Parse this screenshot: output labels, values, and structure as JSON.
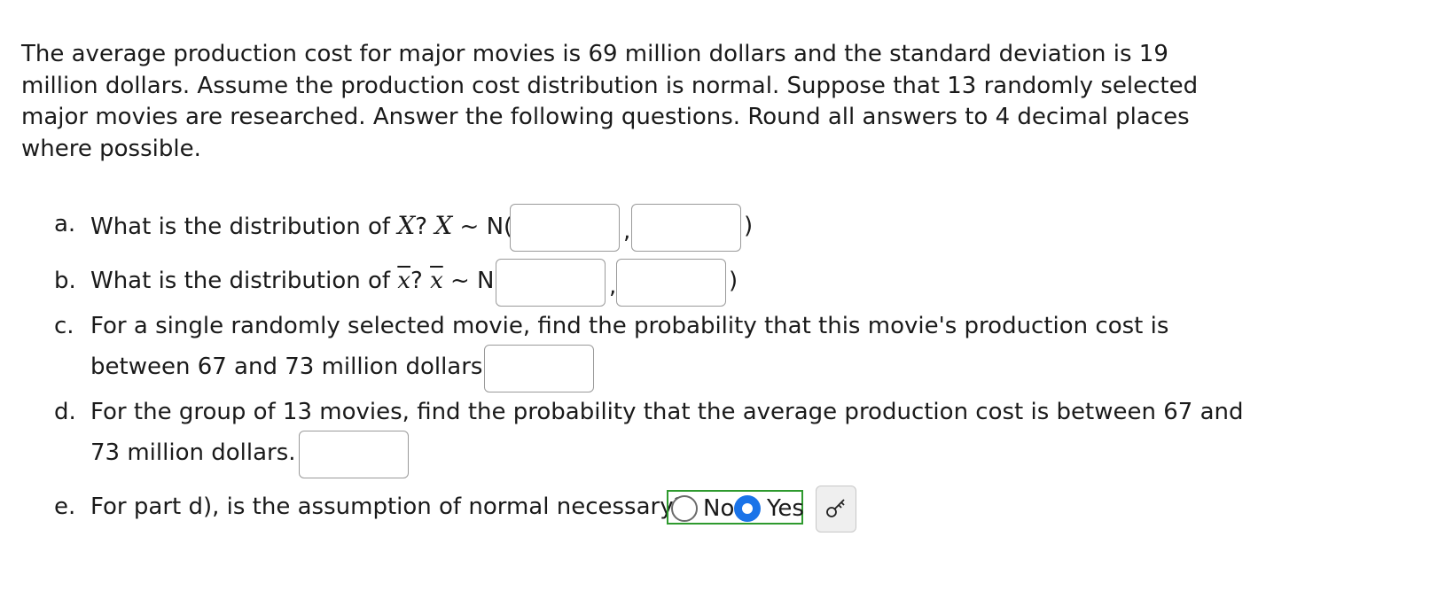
{
  "intro": "The average production cost for major movies is 69 million dollars and the standard deviation is 19 million dollars. Assume the production cost distribution is normal. Suppose that 13 randomly selected major movies are researched. Answer the following questions. Round all answers to 4 decimal places where possible.",
  "questions": {
    "a": {
      "letter": "a.",
      "prefix": "What is the distribution of ",
      "var": "X",
      "mid": "? ",
      "var2": "X",
      "tilde": " ~ N(",
      "comma": ",",
      "close": ")",
      "mean_value": "",
      "sd_value": ""
    },
    "b": {
      "letter": "b.",
      "prefix": "What is the distribution of ",
      "var": "x",
      "mid": "? ",
      "var2": "x",
      "tilde": " ~ N(",
      "comma": ",",
      "close": ")",
      "mean_value": "",
      "sd_value": ""
    },
    "c": {
      "letter": "c.",
      "line1": "For a single randomly selected movie, find the probability that this movie's production cost is",
      "line2": "between 67 and 73 million dollars.",
      "answer_value": ""
    },
    "d": {
      "letter": "d.",
      "line1": "For the group of 13 movies, find the probability that the average production cost is between 67 and",
      "line2": "73 million dollars.",
      "answer_value": ""
    },
    "e": {
      "letter": "e.",
      "text": "For part d), is the assumption of normal necessary?",
      "options": [
        "No",
        "Yes"
      ],
      "selected": "Yes"
    }
  },
  "key_button_icon": "key-icon",
  "colors": {
    "radio_selected": "#1a73e8",
    "group_border": "#2e9a2e"
  }
}
